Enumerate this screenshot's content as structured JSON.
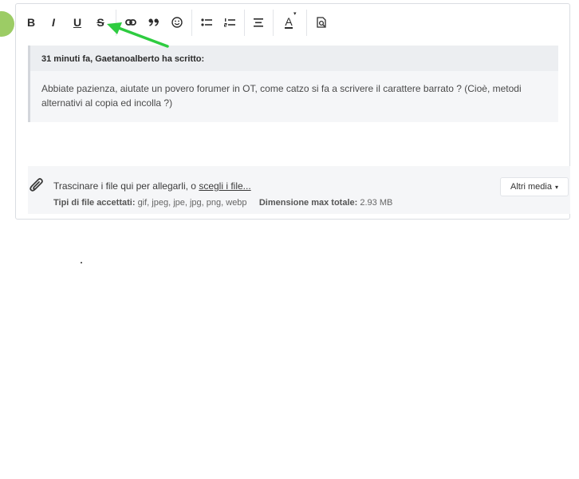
{
  "toolbar": {
    "bold_label": "B",
    "italic_label": "I",
    "underline_label": "U",
    "strike_label": "S",
    "color_label": "A",
    "buttons": [
      "bold",
      "italic",
      "underline",
      "strikethrough",
      "link",
      "quote",
      "emoji",
      "bulleted-list",
      "numbered-list",
      "align",
      "text-color",
      "preview"
    ]
  },
  "quote": {
    "author": "31 minuti fa, Gaetanoalberto ha scritto:",
    "body": "Abbiate pazienza, aiutate un povero forumer in OT, come catzo si fa a scrivere il carattere barrato ? (Cioè, metodi alternativi al copia ed incolla ?)"
  },
  "attachments": {
    "prompt": "Trascinare i file qui per allegarli, o ",
    "choose_link": "scegli i file...",
    "types_label": "Tipi di file accettati:",
    "types_value": "gif, jpeg, jpe, jpg, png, webp",
    "max_label": "Dimensione max totale:",
    "max_value": "2.93 MB",
    "more_media": "Altri media",
    "more_media_caret": "▾"
  },
  "colors": {
    "annotation_arrow": "#2ecc40",
    "avatar": "#9ccc65"
  }
}
